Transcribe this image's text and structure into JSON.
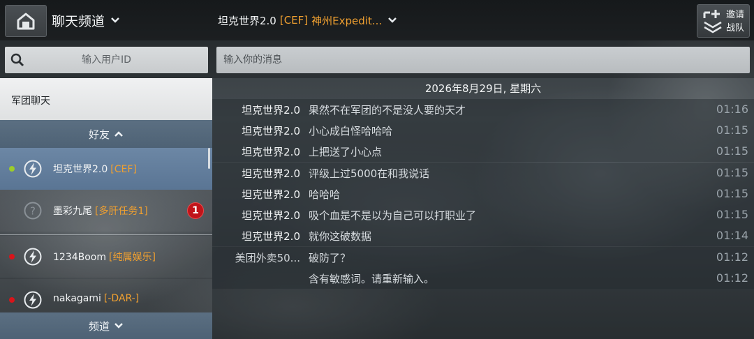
{
  "header": {
    "channel_title": "聊天频道",
    "conversation_name": "坦克世界2.0",
    "conversation_tag": "[CEF]",
    "conversation_group": "神州Expedit...",
    "invite_line1": "邀请",
    "invite_line2": "战队"
  },
  "search": {
    "user_placeholder": "输入用户ID",
    "message_placeholder": "输入你的消息"
  },
  "sidebar": {
    "legion_chat_label": "军团聊天",
    "friends_header": "好友",
    "channels_header": "频道",
    "friends": [
      {
        "name": "坦克世界2.0",
        "tag": "[CEF]",
        "status_color": "#9ccc2a",
        "badge": ""
      },
      {
        "name": "墨彩九尾",
        "tag": "[多肝任务1]",
        "status_color": "",
        "badge": "1"
      },
      {
        "name": "1234Boom",
        "tag": "[纯属娱乐]",
        "status_color": "#d8141a",
        "badge": ""
      },
      {
        "name": "nakagami",
        "tag": "[-DAR-]",
        "status_color": "#d8141a",
        "badge": ""
      }
    ]
  },
  "chat": {
    "date": "2026年8月29日, 星期六",
    "messages": [
      {
        "sender": "坦克世界2.0",
        "text": "果然不在军团的不是没人要的天才",
        "time": "01:16"
      },
      {
        "sender": "坦克世界2.0",
        "text": "小心成白怪哈哈哈",
        "time": "01:15"
      },
      {
        "sender": "坦克世界2.0",
        "text": "上把送了小心点",
        "time": "01:15"
      },
      {
        "sender": "坦克世界2.0",
        "text": "评级上过5000在和我说话",
        "time": "01:15"
      },
      {
        "sender": "坦克世界2.0",
        "text": "哈哈哈",
        "time": "01:15"
      },
      {
        "sender": "坦克世界2.0",
        "text": "吸个血是不是以为自己可以打职业了",
        "time": "01:15"
      },
      {
        "sender": "坦克世界2.0",
        "text": "就你这破数据",
        "time": "01:14"
      },
      {
        "sender": "美团外卖50...",
        "text": "破防了？",
        "time": "01:12"
      },
      {
        "sender": "",
        "text": "含有敏感词。请重新输入。",
        "time": "01:12"
      }
    ]
  },
  "colors": {
    "accent_orange": "#f0a030",
    "online_green": "#9ccc2a",
    "busy_red": "#d8141a",
    "badge_red": "#c0141a",
    "selected_blue": "#6c87a5"
  }
}
